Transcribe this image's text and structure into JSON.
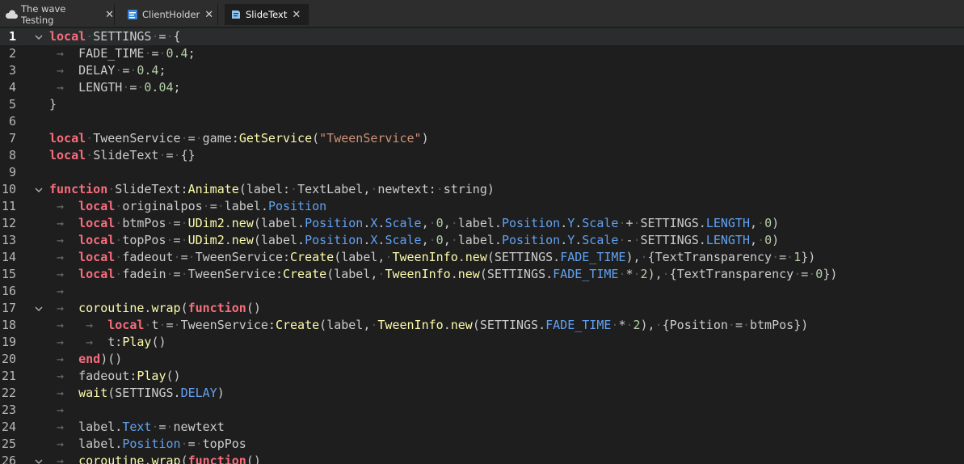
{
  "tabs": [
    {
      "label": "The wave Testing",
      "icon": "cloud-icon",
      "close": "✕"
    },
    {
      "label": "ClientHolder",
      "icon": "script-icon",
      "close": "✕"
    },
    {
      "label": "SlideText",
      "icon": "module-script-icon",
      "close": "✕"
    }
  ],
  "editor": {
    "current_line": 1,
    "lines": [
      {
        "n": "1",
        "fold": true,
        "ind": 0,
        "tokens": [
          [
            "kw",
            "local"
          ],
          [
            "ws",
            "·"
          ],
          [
            "id",
            "SETTINGS"
          ],
          [
            "ws",
            "·"
          ],
          [
            "op",
            "="
          ],
          [
            "ws",
            "·"
          ],
          [
            "op",
            "{"
          ]
        ]
      },
      {
        "n": "2",
        "fold": false,
        "ind": 1,
        "tokens": [
          [
            "id",
            "FADE_TIME"
          ],
          [
            "ws",
            "·"
          ],
          [
            "op",
            "="
          ],
          [
            "ws",
            "·"
          ],
          [
            "num",
            "0.4"
          ],
          [
            "op",
            ";"
          ]
        ]
      },
      {
        "n": "3",
        "fold": false,
        "ind": 1,
        "tokens": [
          [
            "id",
            "DELAY"
          ],
          [
            "ws",
            "·"
          ],
          [
            "op",
            "="
          ],
          [
            "ws",
            "·"
          ],
          [
            "num",
            "0.4"
          ],
          [
            "op",
            ";"
          ]
        ]
      },
      {
        "n": "4",
        "fold": false,
        "ind": 1,
        "tokens": [
          [
            "id",
            "LENGTH"
          ],
          [
            "ws",
            "·"
          ],
          [
            "op",
            "="
          ],
          [
            "ws",
            "·"
          ],
          [
            "num",
            "0.04"
          ],
          [
            "op",
            ";"
          ]
        ]
      },
      {
        "n": "5",
        "fold": false,
        "ind": 0,
        "tokens": [
          [
            "op",
            "}"
          ]
        ]
      },
      {
        "n": "6",
        "fold": false,
        "ind": 0,
        "tokens": []
      },
      {
        "n": "7",
        "fold": false,
        "ind": 0,
        "tokens": [
          [
            "kw",
            "local"
          ],
          [
            "ws",
            "·"
          ],
          [
            "id",
            "TweenService"
          ],
          [
            "ws",
            "·"
          ],
          [
            "op",
            "="
          ],
          [
            "ws",
            "·"
          ],
          [
            "id",
            "game:"
          ],
          [
            "fn",
            "GetService"
          ],
          [
            "op",
            "("
          ],
          [
            "str",
            "\"TweenService\""
          ],
          [
            "op",
            ")"
          ]
        ]
      },
      {
        "n": "8",
        "fold": false,
        "ind": 0,
        "tokens": [
          [
            "kw",
            "local"
          ],
          [
            "ws",
            "·"
          ],
          [
            "id",
            "SlideText"
          ],
          [
            "ws",
            "·"
          ],
          [
            "op",
            "="
          ],
          [
            "ws",
            "·"
          ],
          [
            "op",
            "{}"
          ]
        ]
      },
      {
        "n": "9",
        "fold": false,
        "ind": 0,
        "tokens": []
      },
      {
        "n": "10",
        "fold": true,
        "ind": 0,
        "tokens": [
          [
            "kw",
            "function"
          ],
          [
            "ws",
            "·"
          ],
          [
            "id",
            "SlideText:"
          ],
          [
            "fn",
            "Animate"
          ],
          [
            "op",
            "("
          ],
          [
            "id",
            "label:"
          ],
          [
            "ws",
            "·"
          ],
          [
            "id",
            "TextLabel,"
          ],
          [
            "ws",
            "·"
          ],
          [
            "id",
            "newtext:"
          ],
          [
            "ws",
            "·"
          ],
          [
            "id",
            "string)"
          ]
        ]
      },
      {
        "n": "11",
        "fold": false,
        "ind": 1,
        "tokens": [
          [
            "kw",
            "local"
          ],
          [
            "ws",
            "·"
          ],
          [
            "id",
            "originalpos"
          ],
          [
            "ws",
            "·"
          ],
          [
            "op",
            "="
          ],
          [
            "ws",
            "·"
          ],
          [
            "id",
            "label."
          ],
          [
            "prop",
            "Position"
          ]
        ]
      },
      {
        "n": "12",
        "fold": false,
        "ind": 1,
        "tokens": [
          [
            "kw",
            "local"
          ],
          [
            "ws",
            "·"
          ],
          [
            "id",
            "btmPos"
          ],
          [
            "ws",
            "·"
          ],
          [
            "op",
            "="
          ],
          [
            "ws",
            "·"
          ],
          [
            "fn",
            "UDim2"
          ],
          [
            "id",
            "."
          ],
          [
            "fn",
            "new"
          ],
          [
            "op",
            "("
          ],
          [
            "id",
            "label."
          ],
          [
            "prop",
            "Position"
          ],
          [
            "id",
            "."
          ],
          [
            "prop",
            "X"
          ],
          [
            "id",
            "."
          ],
          [
            "prop",
            "Scale"
          ],
          [
            "id",
            ","
          ],
          [
            "ws",
            "·"
          ],
          [
            "num",
            "0"
          ],
          [
            "id",
            ","
          ],
          [
            "ws",
            "·"
          ],
          [
            "id",
            "label."
          ],
          [
            "prop",
            "Position"
          ],
          [
            "id",
            "."
          ],
          [
            "prop",
            "Y"
          ],
          [
            "id",
            "."
          ],
          [
            "prop",
            "Scale"
          ],
          [
            "ws",
            "·"
          ],
          [
            "op",
            "+"
          ],
          [
            "ws",
            "·"
          ],
          [
            "id",
            "SETTINGS."
          ],
          [
            "prop",
            "LENGTH"
          ],
          [
            "id",
            ","
          ],
          [
            "ws",
            "·"
          ],
          [
            "num",
            "0"
          ],
          [
            "op",
            ")"
          ]
        ]
      },
      {
        "n": "13",
        "fold": false,
        "ind": 1,
        "tokens": [
          [
            "kw",
            "local"
          ],
          [
            "ws",
            "·"
          ],
          [
            "id",
            "topPos"
          ],
          [
            "ws",
            "·"
          ],
          [
            "op",
            "="
          ],
          [
            "ws",
            "·"
          ],
          [
            "fn",
            "UDim2"
          ],
          [
            "id",
            "."
          ],
          [
            "fn",
            "new"
          ],
          [
            "op",
            "("
          ],
          [
            "id",
            "label."
          ],
          [
            "prop",
            "Position"
          ],
          [
            "id",
            "."
          ],
          [
            "prop",
            "X"
          ],
          [
            "id",
            "."
          ],
          [
            "prop",
            "Scale"
          ],
          [
            "id",
            ","
          ],
          [
            "ws",
            "·"
          ],
          [
            "num",
            "0"
          ],
          [
            "id",
            ","
          ],
          [
            "ws",
            "·"
          ],
          [
            "id",
            "label."
          ],
          [
            "prop",
            "Position"
          ],
          [
            "id",
            "."
          ],
          [
            "prop",
            "Y"
          ],
          [
            "id",
            "."
          ],
          [
            "prop",
            "Scale"
          ],
          [
            "ws",
            "·"
          ],
          [
            "op",
            "-"
          ],
          [
            "ws",
            "·"
          ],
          [
            "id",
            "SETTINGS."
          ],
          [
            "prop",
            "LENGTH"
          ],
          [
            "id",
            ","
          ],
          [
            "ws",
            "·"
          ],
          [
            "num",
            "0"
          ],
          [
            "op",
            ")"
          ]
        ]
      },
      {
        "n": "14",
        "fold": false,
        "ind": 1,
        "tokens": [
          [
            "kw",
            "local"
          ],
          [
            "ws",
            "·"
          ],
          [
            "id",
            "fadeout"
          ],
          [
            "ws",
            "·"
          ],
          [
            "op",
            "="
          ],
          [
            "ws",
            "·"
          ],
          [
            "id",
            "TweenService:"
          ],
          [
            "fn",
            "Create"
          ],
          [
            "op",
            "("
          ],
          [
            "id",
            "label,"
          ],
          [
            "ws",
            "·"
          ],
          [
            "fn",
            "TweenInfo"
          ],
          [
            "id",
            "."
          ],
          [
            "fn",
            "new"
          ],
          [
            "op",
            "("
          ],
          [
            "id",
            "SETTINGS."
          ],
          [
            "prop",
            "FADE_TIME"
          ],
          [
            "op",
            "),"
          ],
          [
            "ws",
            "·"
          ],
          [
            "op",
            "{"
          ],
          [
            "id",
            "TextTransparency"
          ],
          [
            "ws",
            "·"
          ],
          [
            "op",
            "="
          ],
          [
            "ws",
            "·"
          ],
          [
            "num",
            "1"
          ],
          [
            "op",
            "})"
          ]
        ]
      },
      {
        "n": "15",
        "fold": false,
        "ind": 1,
        "tokens": [
          [
            "kw",
            "local"
          ],
          [
            "ws",
            "·"
          ],
          [
            "id",
            "fadein"
          ],
          [
            "ws",
            "·"
          ],
          [
            "op",
            "="
          ],
          [
            "ws",
            "·"
          ],
          [
            "id",
            "TweenService:"
          ],
          [
            "fn",
            "Create"
          ],
          [
            "op",
            "("
          ],
          [
            "id",
            "label,"
          ],
          [
            "ws",
            "·"
          ],
          [
            "fn",
            "TweenInfo"
          ],
          [
            "id",
            "."
          ],
          [
            "fn",
            "new"
          ],
          [
            "op",
            "("
          ],
          [
            "id",
            "SETTINGS."
          ],
          [
            "prop",
            "FADE_TIME"
          ],
          [
            "ws",
            "·"
          ],
          [
            "op",
            "*"
          ],
          [
            "ws",
            "·"
          ],
          [
            "num",
            "2"
          ],
          [
            "op",
            "),"
          ],
          [
            "ws",
            "·"
          ],
          [
            "op",
            "{"
          ],
          [
            "id",
            "TextTransparency"
          ],
          [
            "ws",
            "·"
          ],
          [
            "op",
            "="
          ],
          [
            "ws",
            "·"
          ],
          [
            "num",
            "0"
          ],
          [
            "op",
            "})"
          ]
        ]
      },
      {
        "n": "16",
        "fold": false,
        "ind": 1,
        "tokens": []
      },
      {
        "n": "17",
        "fold": true,
        "ind": 1,
        "tokens": [
          [
            "fn",
            "coroutine"
          ],
          [
            "id",
            "."
          ],
          [
            "fn",
            "wrap"
          ],
          [
            "op",
            "("
          ],
          [
            "kw",
            "function"
          ],
          [
            "op",
            "()"
          ]
        ]
      },
      {
        "n": "18",
        "fold": false,
        "ind": 2,
        "tokens": [
          [
            "kw",
            "local"
          ],
          [
            "ws",
            "·"
          ],
          [
            "id",
            "t"
          ],
          [
            "ws",
            "·"
          ],
          [
            "op",
            "="
          ],
          [
            "ws",
            "·"
          ],
          [
            "id",
            "TweenService:"
          ],
          [
            "fn",
            "Create"
          ],
          [
            "op",
            "("
          ],
          [
            "id",
            "label,"
          ],
          [
            "ws",
            "·"
          ],
          [
            "fn",
            "TweenInfo"
          ],
          [
            "id",
            "."
          ],
          [
            "fn",
            "new"
          ],
          [
            "op",
            "("
          ],
          [
            "id",
            "SETTINGS."
          ],
          [
            "prop",
            "FADE_TIME"
          ],
          [
            "ws",
            "·"
          ],
          [
            "op",
            "*"
          ],
          [
            "ws",
            "·"
          ],
          [
            "num",
            "2"
          ],
          [
            "op",
            "),"
          ],
          [
            "ws",
            "·"
          ],
          [
            "op",
            "{"
          ],
          [
            "id",
            "Position"
          ],
          [
            "ws",
            "·"
          ],
          [
            "op",
            "="
          ],
          [
            "ws",
            "·"
          ],
          [
            "id",
            "btmPos"
          ],
          [
            "op",
            "})"
          ]
        ]
      },
      {
        "n": "19",
        "fold": false,
        "ind": 2,
        "tokens": [
          [
            "id",
            "t:"
          ],
          [
            "fn",
            "Play"
          ],
          [
            "op",
            "()"
          ]
        ]
      },
      {
        "n": "20",
        "fold": false,
        "ind": 1,
        "tokens": [
          [
            "kw",
            "end"
          ],
          [
            "op",
            ")()"
          ]
        ]
      },
      {
        "n": "21",
        "fold": false,
        "ind": 1,
        "tokens": [
          [
            "id",
            "fadeout:"
          ],
          [
            "fn",
            "Play"
          ],
          [
            "op",
            "()"
          ]
        ]
      },
      {
        "n": "22",
        "fold": false,
        "ind": 1,
        "tokens": [
          [
            "fn",
            "wait"
          ],
          [
            "op",
            "("
          ],
          [
            "id",
            "SETTINGS."
          ],
          [
            "prop",
            "DELAY"
          ],
          [
            "op",
            ")"
          ]
        ]
      },
      {
        "n": "23",
        "fold": false,
        "ind": 1,
        "tokens": []
      },
      {
        "n": "24",
        "fold": false,
        "ind": 1,
        "tokens": [
          [
            "id",
            "label."
          ],
          [
            "prop",
            "Text"
          ],
          [
            "ws",
            "·"
          ],
          [
            "op",
            "="
          ],
          [
            "ws",
            "·"
          ],
          [
            "id",
            "newtext"
          ]
        ]
      },
      {
        "n": "25",
        "fold": false,
        "ind": 1,
        "tokens": [
          [
            "id",
            "label."
          ],
          [
            "prop",
            "Position"
          ],
          [
            "ws",
            "·"
          ],
          [
            "op",
            "="
          ],
          [
            "ws",
            "·"
          ],
          [
            "id",
            "topPos"
          ]
        ]
      },
      {
        "n": "26",
        "fold": true,
        "ind": 1,
        "tokens": [
          [
            "fn",
            "coroutine"
          ],
          [
            "id",
            "."
          ],
          [
            "fn",
            "wrap"
          ],
          [
            "op",
            "("
          ],
          [
            "kw",
            "function"
          ],
          [
            "op",
            "()"
          ]
        ]
      }
    ]
  }
}
